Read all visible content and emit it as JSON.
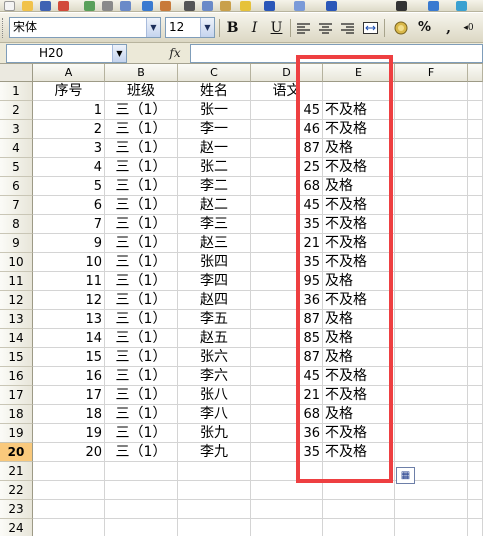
{
  "toolbar": {
    "font_name": "宋体",
    "font_size": "12",
    "bold_label": "B",
    "italic_label": "I",
    "underline_label": "U",
    "percent_label": "%",
    "comma_label": ","
  },
  "formula_bar": {
    "name_box": "H20",
    "fx_label": "fx",
    "formula": ""
  },
  "columns": [
    "A",
    "B",
    "C",
    "D",
    "E",
    "F"
  ],
  "rows": [
    {
      "num": "1",
      "a": "序号",
      "b": "班级",
      "c": "姓名",
      "d": "语文",
      "e": ""
    },
    {
      "num": "2",
      "a": "1",
      "b": "三（1）",
      "c": "张一",
      "d": "45",
      "e": "不及格"
    },
    {
      "num": "3",
      "a": "2",
      "b": "三（1）",
      "c": "李一",
      "d": "46",
      "e": "不及格"
    },
    {
      "num": "4",
      "a": "3",
      "b": "三（1）",
      "c": "赵一",
      "d": "87",
      "e": "及格"
    },
    {
      "num": "5",
      "a": "4",
      "b": "三（1）",
      "c": "张二",
      "d": "25",
      "e": "不及格"
    },
    {
      "num": "6",
      "a": "5",
      "b": "三（1）",
      "c": "李二",
      "d": "68",
      "e": "及格"
    },
    {
      "num": "7",
      "a": "6",
      "b": "三（1）",
      "c": "赵二",
      "d": "45",
      "e": "不及格"
    },
    {
      "num": "8",
      "a": "7",
      "b": "三（1）",
      "c": "李三",
      "d": "35",
      "e": "不及格"
    },
    {
      "num": "9",
      "a": "9",
      "b": "三（1）",
      "c": "赵三",
      "d": "21",
      "e": "不及格"
    },
    {
      "num": "10",
      "a": "10",
      "b": "三（1）",
      "c": "张四",
      "d": "35",
      "e": "不及格"
    },
    {
      "num": "11",
      "a": "11",
      "b": "三（1）",
      "c": "李四",
      "d": "95",
      "e": "及格"
    },
    {
      "num": "12",
      "a": "12",
      "b": "三（1）",
      "c": "赵四",
      "d": "36",
      "e": "不及格"
    },
    {
      "num": "13",
      "a": "13",
      "b": "三（1）",
      "c": "李五",
      "d": "87",
      "e": "及格"
    },
    {
      "num": "14",
      "a": "14",
      "b": "三（1）",
      "c": "赵五",
      "d": "85",
      "e": "及格"
    },
    {
      "num": "15",
      "a": "15",
      "b": "三（1）",
      "c": "张六",
      "d": "87",
      "e": "及格"
    },
    {
      "num": "16",
      "a": "16",
      "b": "三（1）",
      "c": "李六",
      "d": "45",
      "e": "不及格"
    },
    {
      "num": "17",
      "a": "17",
      "b": "三（1）",
      "c": "张八",
      "d": "21",
      "e": "不及格"
    },
    {
      "num": "18",
      "a": "18",
      "b": "三（1）",
      "c": "李八",
      "d": "68",
      "e": "及格"
    },
    {
      "num": "19",
      "a": "19",
      "b": "三（1）",
      "c": "张九",
      "d": "36",
      "e": "不及格"
    },
    {
      "num": "20",
      "a": "20",
      "b": "三（1）",
      "c": "李九",
      "d": "35",
      "e": "不及格"
    },
    {
      "num": "21",
      "a": "",
      "b": "",
      "c": "",
      "d": "",
      "e": ""
    },
    {
      "num": "22",
      "a": "",
      "b": "",
      "c": "",
      "d": "",
      "e": ""
    },
    {
      "num": "23",
      "a": "",
      "b": "",
      "c": "",
      "d": "",
      "e": ""
    },
    {
      "num": "24",
      "a": "",
      "b": "",
      "c": "",
      "d": "",
      "e": ""
    }
  ],
  "colors": {
    "highlight": "#ee3f41",
    "active_row_header": "#f9c97c"
  }
}
